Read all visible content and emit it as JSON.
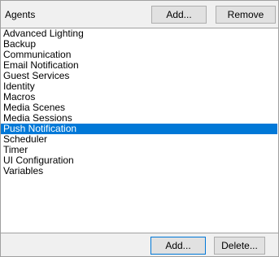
{
  "header": {
    "title": "Agents",
    "add_label": "Add...",
    "remove_label": "Remove"
  },
  "list": {
    "items": [
      "Advanced Lighting",
      "Backup",
      "Communication",
      "Email Notification",
      "Guest Services",
      "Identity",
      "Macros",
      "Media Scenes",
      "Media Sessions",
      "Push Notification",
      "Scheduler",
      "Timer",
      "UI Configuration",
      "Variables"
    ],
    "selected": "Push Notification"
  },
  "footer": {
    "add_label": "Add...",
    "delete_label": "Delete..."
  },
  "colors": {
    "selection": "#0078d7",
    "focus_border": "#0078d7"
  }
}
